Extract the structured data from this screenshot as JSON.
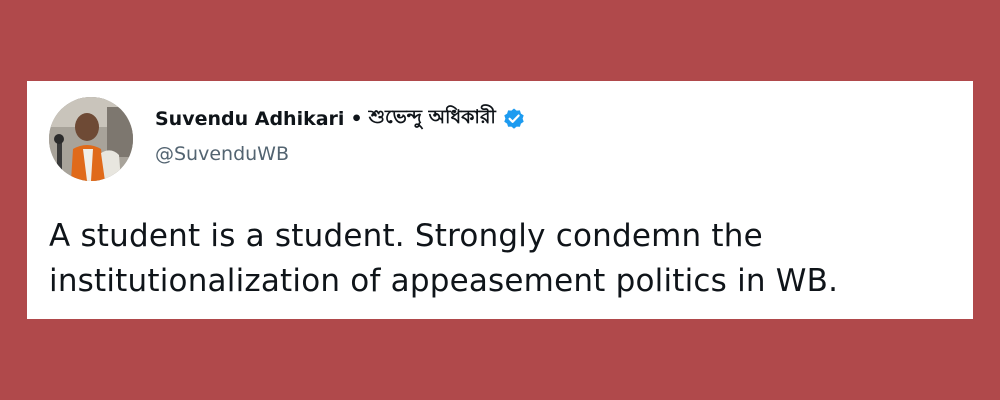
{
  "tweet": {
    "author_name": "Suvendu Adhikari",
    "separator": "•",
    "author_name_bengali": "শুভেন্দু অধিকারী",
    "verified_icon": "verified-badge-icon",
    "handle": "@SuvenduWB",
    "text_lines": [
      "A student is a student. Strongly condemn the",
      "institutionalization of appeasement politics in WB."
    ]
  },
  "colors": {
    "background": "#b0494b",
    "card": "#ffffff",
    "verified": "#1d9bf0",
    "text_primary": "#0f1419",
    "text_secondary": "#536471"
  }
}
